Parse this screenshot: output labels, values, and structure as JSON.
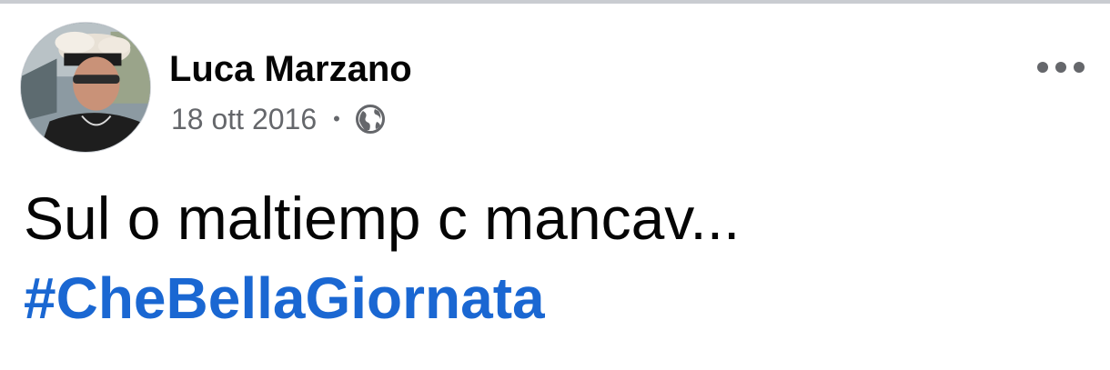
{
  "post": {
    "author": {
      "name": "Luca Marzano",
      "avatar_icon": "profile-photo"
    },
    "date": "18 ott 2016",
    "separator": "•",
    "privacy_icon": "globe-icon",
    "more_icon": "more-options-icon",
    "text": "Sul o maltiemp c mancav...",
    "hashtag": "#CheBellaGiornata"
  },
  "colors": {
    "name": "#050505",
    "meta": "#65676b",
    "hashtag": "#1a67d2",
    "background": "#ffffff"
  }
}
